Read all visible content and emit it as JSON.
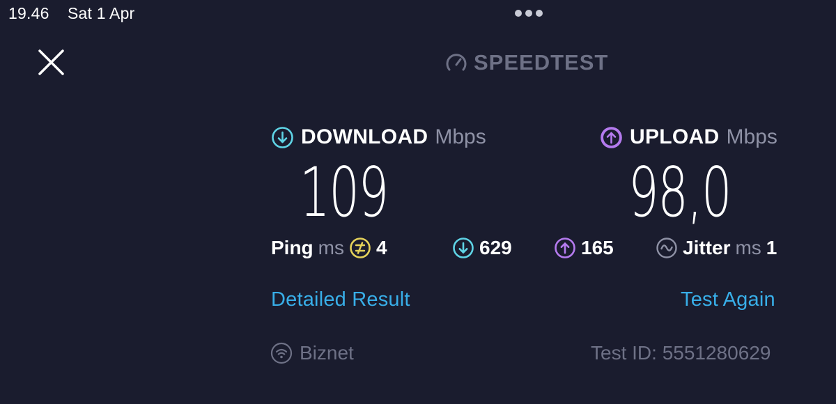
{
  "status_bar": {
    "time": "19.46",
    "date": "Sat 1 Apr"
  },
  "header": {
    "brand": "SPEEDTEST",
    "brand_color": "#6e7186"
  },
  "download": {
    "label": "DOWNLOAD",
    "unit": "Mbps",
    "value": "109",
    "icon": "arrow-down-circle-icon",
    "color": "#5fd4e6"
  },
  "upload": {
    "label": "UPLOAD",
    "unit": "Mbps",
    "value": "98,0",
    "icon": "arrow-up-circle-icon",
    "color": "#b57bef"
  },
  "ping": {
    "label": "Ping",
    "unit": "ms",
    "idle_value": "4",
    "idle_icon": "idle-latency-icon",
    "idle_color": "#e6d35a",
    "download_latency": "629",
    "upload_latency": "165"
  },
  "jitter": {
    "label": "Jitter",
    "unit": "ms",
    "value": "1",
    "icon": "jitter-wave-icon"
  },
  "actions": {
    "detailed_result": "Detailed Result",
    "test_again": "Test Again",
    "link_color": "#38aee8"
  },
  "footer": {
    "isp": "Biznet",
    "isp_icon": "wifi-icon",
    "test_id": "Test ID: 5551280629"
  }
}
